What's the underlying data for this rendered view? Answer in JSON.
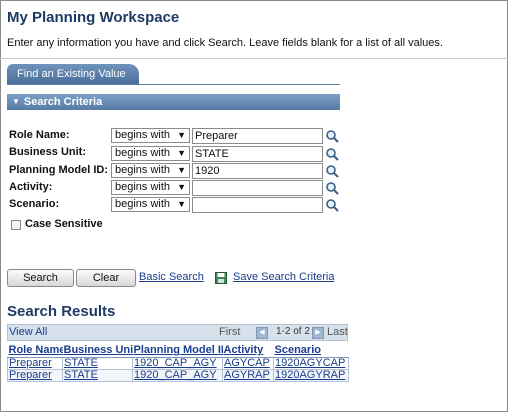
{
  "page": {
    "title": "My Planning Workspace",
    "instructions": "Enter any information you have and click Search. Leave fields blank for a list of all values."
  },
  "tabs": [
    {
      "label": "Find an Existing Value",
      "active": true
    }
  ],
  "search_criteria": {
    "header": "Search Criteria",
    "fields": [
      {
        "label": "Role Name:",
        "operator": "begins with",
        "value": "Preparer"
      },
      {
        "label": "Business Unit:",
        "operator": "begins with",
        "value": "STATE"
      },
      {
        "label": "Planning Model ID:",
        "operator": "begins with",
        "value": "1920"
      },
      {
        "label": "Activity:",
        "operator": "begins with",
        "value": ""
      },
      {
        "label": "Scenario:",
        "operator": "begins with",
        "value": ""
      }
    ],
    "case_sensitive": {
      "label": "Case Sensitive",
      "checked": false
    },
    "operator_arrow": "▼"
  },
  "actions": {
    "search": "Search",
    "clear": "Clear",
    "basic_search": "Basic Search",
    "save_criteria": "Save Search Criteria"
  },
  "results": {
    "title": "Search Results",
    "view_all": "View All",
    "first": "First",
    "count": "1-2 of 2",
    "last": "Last",
    "prev_icon": "◀",
    "next_icon": "▶",
    "columns": [
      "Role Name",
      "Business Unit",
      "Planning Model ID",
      "Activity",
      "Scenario"
    ],
    "rows": [
      [
        "Preparer",
        "STATE",
        "1920_CAP_AGY",
        "AGYCAP",
        "1920AGYCAP"
      ],
      [
        "Preparer",
        "STATE",
        "1920_CAP_AGY",
        "AGYRAP",
        "1920AGYRAP"
      ]
    ]
  },
  "colors": {
    "title": "#1f3b63",
    "link": "#1a3d8c",
    "header_bar": "#557aa5",
    "grid_bar": "#d7e1ec"
  }
}
